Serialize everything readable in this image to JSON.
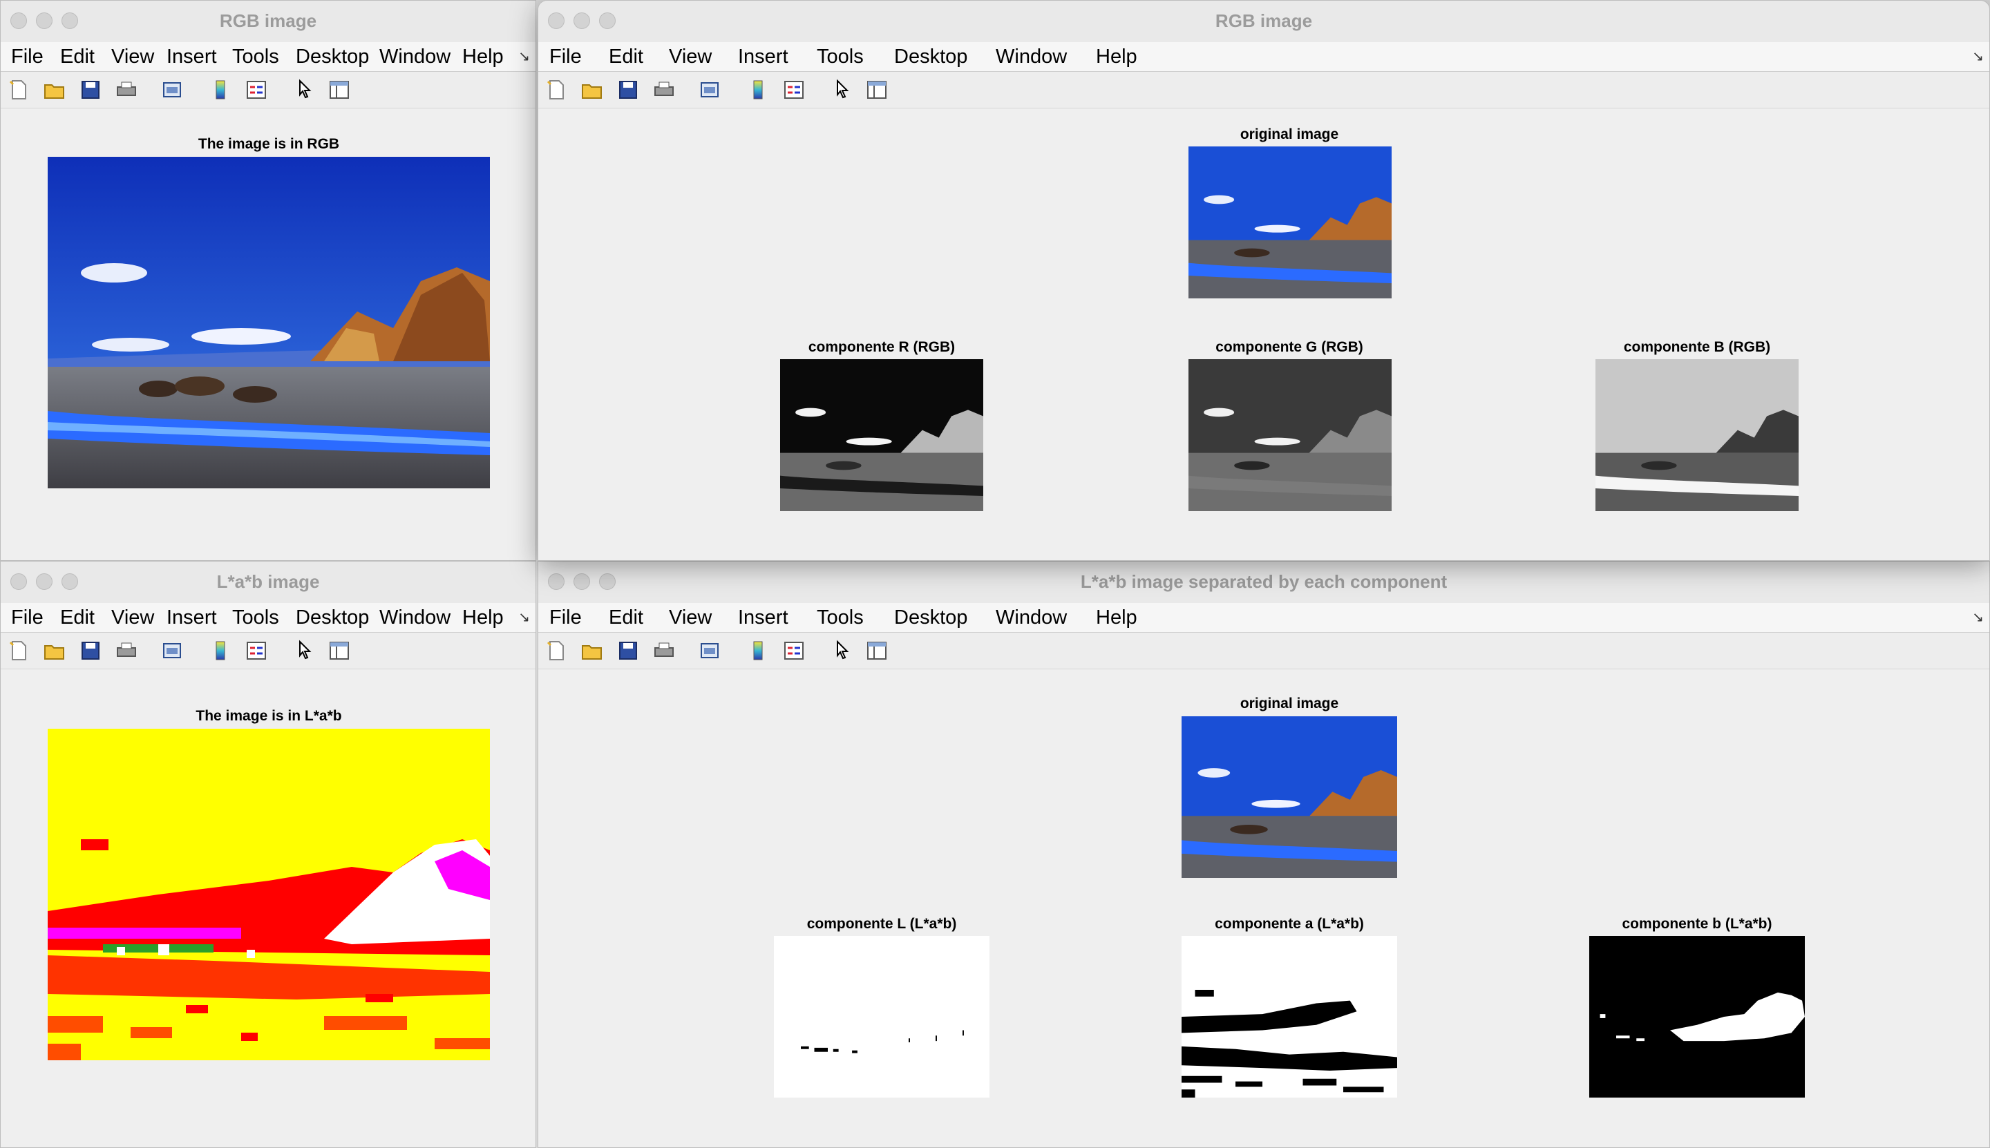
{
  "menu": [
    "File",
    "Edit",
    "View",
    "Insert",
    "Tools",
    "Desktop",
    "Window",
    "Help"
  ],
  "menu_narrow": [
    "File",
    "Edit",
    "View",
    "Insert",
    "Tools",
    "Desktop",
    "Window",
    "Help"
  ],
  "toolbar_icons": [
    "new-file-icon",
    "open-folder-icon",
    "save-icon",
    "print-icon",
    "print-preview-icon",
    "colorbar-icon",
    "legend-icon",
    "pointer-icon",
    "property-editor-icon"
  ],
  "windows": {
    "rgb_single": {
      "title": "RGB image",
      "axes_title": "The image is in RGB"
    },
    "rgb_components": {
      "title": "RGB image",
      "original_title": "original image",
      "comp_r": "componente R (RGB)",
      "comp_g": "componente G (RGB)",
      "comp_b": "componente B (RGB)"
    },
    "lab_single": {
      "title": "L*a*b image",
      "axes_title": "The image is in L*a*b"
    },
    "lab_components": {
      "title": "L*a*b image separated by each component",
      "original_title": "original image",
      "comp_l": "componente L (L*a*b)",
      "comp_a": "componente a (L*a*b)",
      "comp_b": "componente b (L*a*b)"
    }
  },
  "background_text": "... . . . ."
}
